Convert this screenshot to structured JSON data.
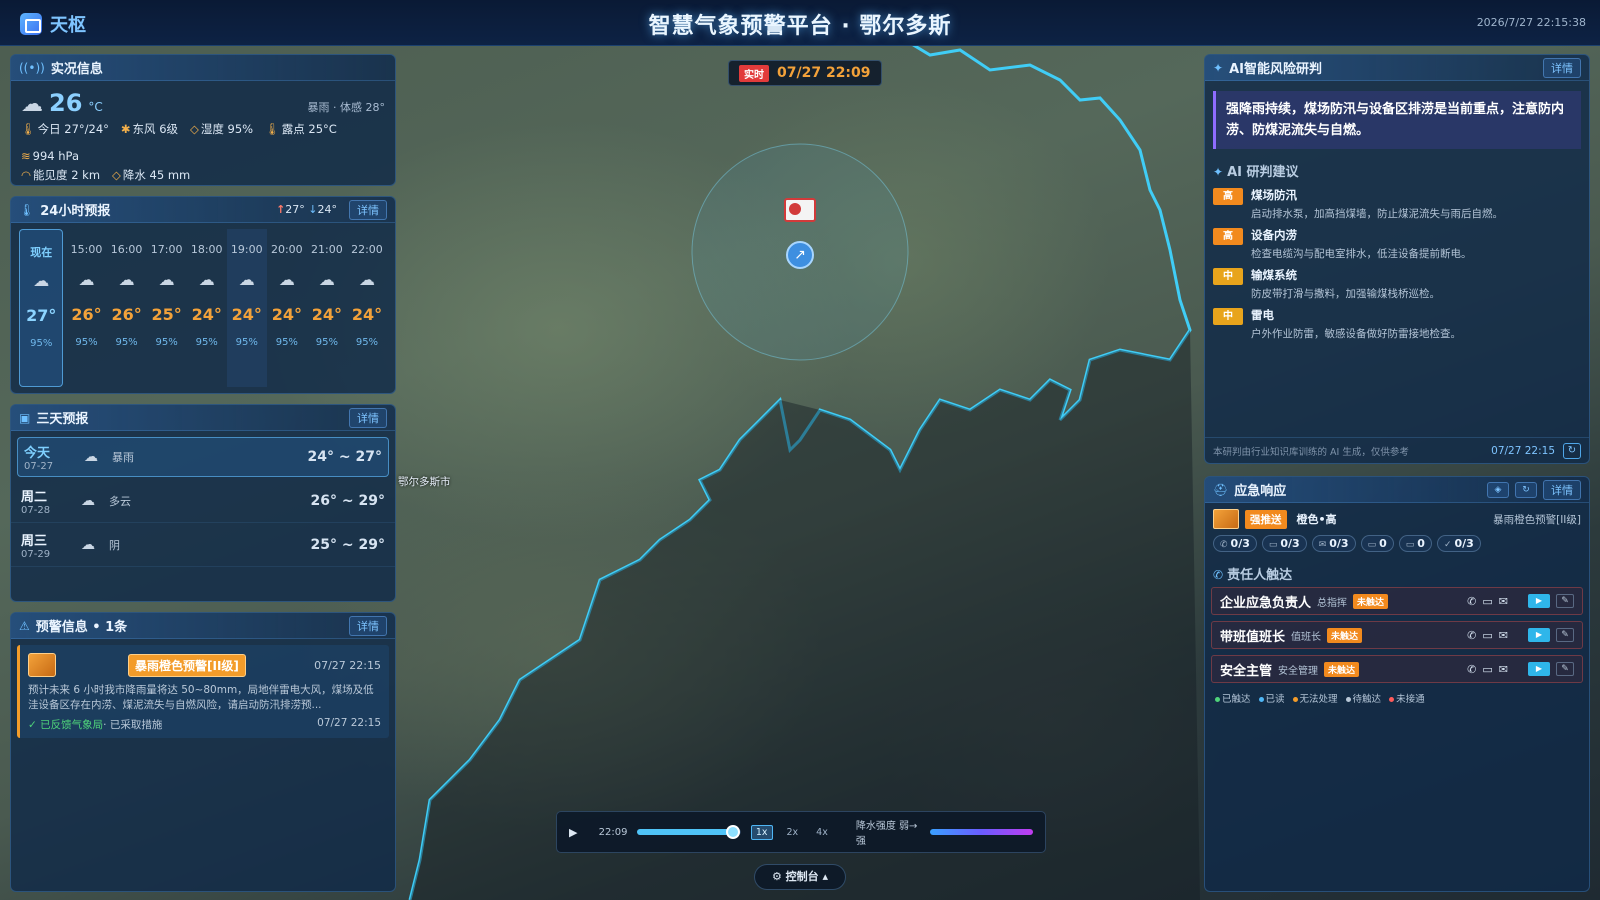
{
  "header": {
    "logo_text": "天枢",
    "title": "智慧气象预警平台 · 鄂尔多斯",
    "clock": "2026/7/27 22:15:38"
  },
  "realtime": {
    "title": "实况信息",
    "temp": "26",
    "unit": "°C",
    "desc": "暴雨 · 体感 28°",
    "today_range": "今日 27°/24°",
    "wind": "东风 6级",
    "humidity": "湿度 95%",
    "dewpoint": "露点 25°C",
    "pressure": "994 hPa",
    "visibility": "能见度 2 km",
    "precip": "降水 45 mm"
  },
  "hourly": {
    "title": "24小时预报",
    "high": "27°",
    "low": "24°",
    "detail": "详情",
    "items": [
      {
        "time": "现在",
        "temp": "27°",
        "hum": "95%"
      },
      {
        "time": "15:00",
        "temp": "26°",
        "hum": "95%"
      },
      {
        "time": "16:00",
        "temp": "26°",
        "hum": "95%"
      },
      {
        "time": "17:00",
        "temp": "25°",
        "hum": "95%"
      },
      {
        "time": "18:00",
        "temp": "24°",
        "hum": "95%"
      },
      {
        "time": "19:00",
        "temp": "24°",
        "hum": "95%"
      },
      {
        "time": "20:00",
        "temp": "24°",
        "hum": "95%"
      },
      {
        "time": "21:00",
        "temp": "24°",
        "hum": "95%"
      },
      {
        "time": "22:00",
        "temp": "24°",
        "hum": "95%"
      }
    ]
  },
  "three_day": {
    "title": "三天预报",
    "detail": "详情",
    "days": [
      {
        "name": "今天",
        "date": "07-27",
        "weather": "暴雨",
        "range": "24° ~ 27°"
      },
      {
        "name": "周二",
        "date": "07-28",
        "weather": "多云",
        "range": "26° ~ 29°"
      },
      {
        "name": "周三",
        "date": "07-29",
        "weather": "阴",
        "range": "25° ~ 29°"
      }
    ]
  },
  "warning": {
    "title": "预警信息 • 1条",
    "detail": "详情",
    "tag": "暴雨橙色预警[II级]",
    "time": "07/27 22:15",
    "text": "预计未来 6 小时我市降雨量将达 50~80mm，局地伴雷电大风，煤场及低洼设备区存在内涝、煤泥流失与自燃风险，请启动防汛排涝预...",
    "feedback": "✓ 已反馈气象局",
    "status": " · 已采取措施",
    "foot_time": "07/27 22:15"
  },
  "map": {
    "live_tag": "实时",
    "time": "07/27 22:09",
    "city": "鄂尔多斯市",
    "player_time": "22:09",
    "speeds": [
      "1x",
      "2x",
      "4x"
    ],
    "legend_label": "降水强度 弱→强",
    "console": "控制台",
    "progress": 0.92
  },
  "ai": {
    "title": "AI智能风险研判",
    "detail": "详情",
    "summary": "强降雨持续，煤场防汛与设备区排涝是当前重点，注意防内涝、防煤泥流失与自燃。",
    "sub_title": "AI 研判建议",
    "items": [
      {
        "level": "高",
        "title": "煤场防汛",
        "desc": "启动排水泵，加高挡煤墙，防止煤泥流失与雨后自燃。"
      },
      {
        "level": "高",
        "title": "设备内涝",
        "desc": "检查电缆沟与配电室排水，低洼设备提前断电。"
      },
      {
        "level": "中",
        "title": "输煤系统",
        "desc": "防皮带打滑与撒料，加强输煤栈桥巡检。"
      },
      {
        "level": "中",
        "title": "雷电",
        "desc": "户外作业防雷，敏感设备做好防雷接地检查。"
      }
    ],
    "footer": "本研判由行业知识库训练的 AI 生成，仅供参考",
    "footer_time": "07/27 22:15"
  },
  "emergency": {
    "title": "应急响应",
    "detail": "详情",
    "push": "强推送",
    "level": "橙色•高",
    "type": "暴雨橙色预警[II级]",
    "stats": [
      "0/3",
      "0/3",
      "0/3",
      "0",
      "0",
      "0/3"
    ],
    "sub_title": "责任人触达",
    "persons": [
      {
        "name": "企业应急负责人",
        "role": "总指挥",
        "status": "未触达"
      },
      {
        "name": "带班值班长",
        "role": "值班长",
        "status": "未触达"
      },
      {
        "name": "安全主管",
        "role": "安全管理",
        "status": "未触达"
      }
    ],
    "legend": [
      "已触达",
      "已读",
      "无法处理",
      "待触达",
      "未接通"
    ]
  }
}
